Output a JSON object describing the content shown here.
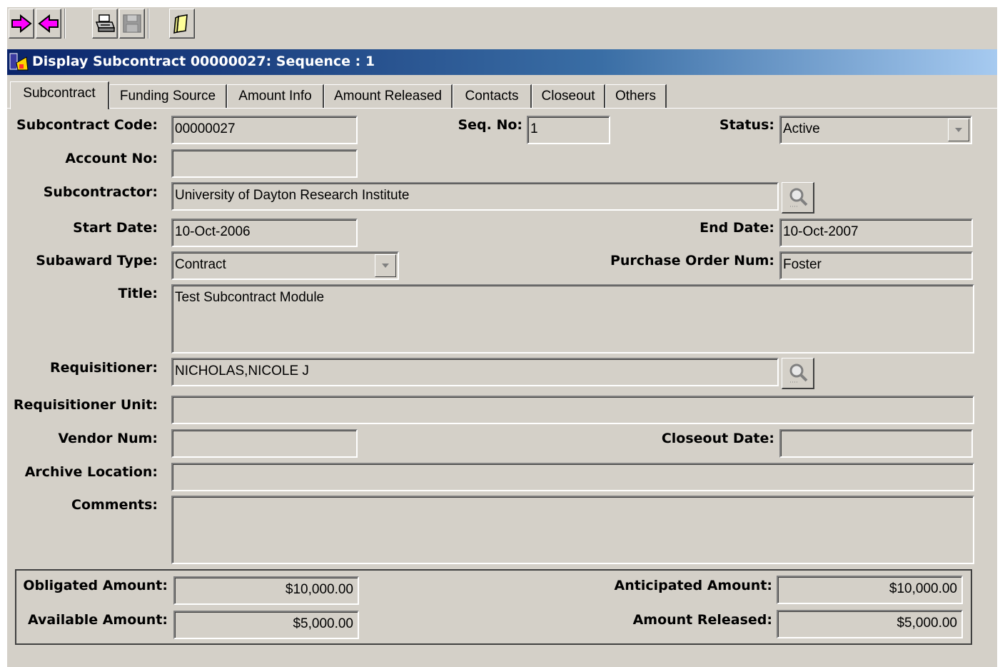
{
  "window": {
    "title": "Display Subcontract 00000027: Sequence : 1"
  },
  "toolbar": {
    "buttons": [
      "forward-icon",
      "back-icon",
      "print-icon",
      "save-icon",
      "notes-icon"
    ]
  },
  "tabs": [
    {
      "label": "Subcontract",
      "active": true
    },
    {
      "label": "Funding Source"
    },
    {
      "label": "Amount Info"
    },
    {
      "label": "Amount Released"
    },
    {
      "label": "Contacts"
    },
    {
      "label": "Closeout"
    },
    {
      "label": "Others"
    }
  ],
  "form": {
    "subcontract_code": {
      "label": "Subcontract Code:",
      "value": "00000027"
    },
    "seq_no": {
      "label": "Seq. No:",
      "value": "1"
    },
    "status": {
      "label": "Status:",
      "value": "Active"
    },
    "account_no": {
      "label": "Account No:",
      "value": ""
    },
    "subcontractor": {
      "label": "Subcontractor:",
      "value": "University of Dayton Research Institute"
    },
    "start_date": {
      "label": "Start Date:",
      "value": "10-Oct-2006"
    },
    "end_date": {
      "label": "End Date:",
      "value": "10-Oct-2007"
    },
    "subaward_type": {
      "label": "Subaward Type:",
      "value": "Contract"
    },
    "purchase_order_num": {
      "label": "Purchase Order Num:",
      "value": "Foster"
    },
    "title": {
      "label": "Title:",
      "value": "Test Subcontract Module"
    },
    "requisitioner": {
      "label": "Requisitioner:",
      "value": "NICHOLAS,NICOLE J"
    },
    "requisitioner_unit": {
      "label": "Requisitioner Unit:",
      "value": ""
    },
    "vendor_num": {
      "label": "Vendor Num:",
      "value": ""
    },
    "closeout_date": {
      "label": "Closeout Date:",
      "value": ""
    },
    "archive_location": {
      "label": "Archive Location:",
      "value": ""
    },
    "comments": {
      "label": "Comments:",
      "value": ""
    }
  },
  "amounts": {
    "obligated": {
      "label": "Obligated Amount:",
      "value": "$10,000.00"
    },
    "anticipated": {
      "label": "Anticipated Amount:",
      "value": "$10,000.00"
    },
    "available": {
      "label": "Available Amount:",
      "value": "$5,000.00"
    },
    "released": {
      "label": "Amount Released:",
      "value": "$5,000.00"
    }
  }
}
